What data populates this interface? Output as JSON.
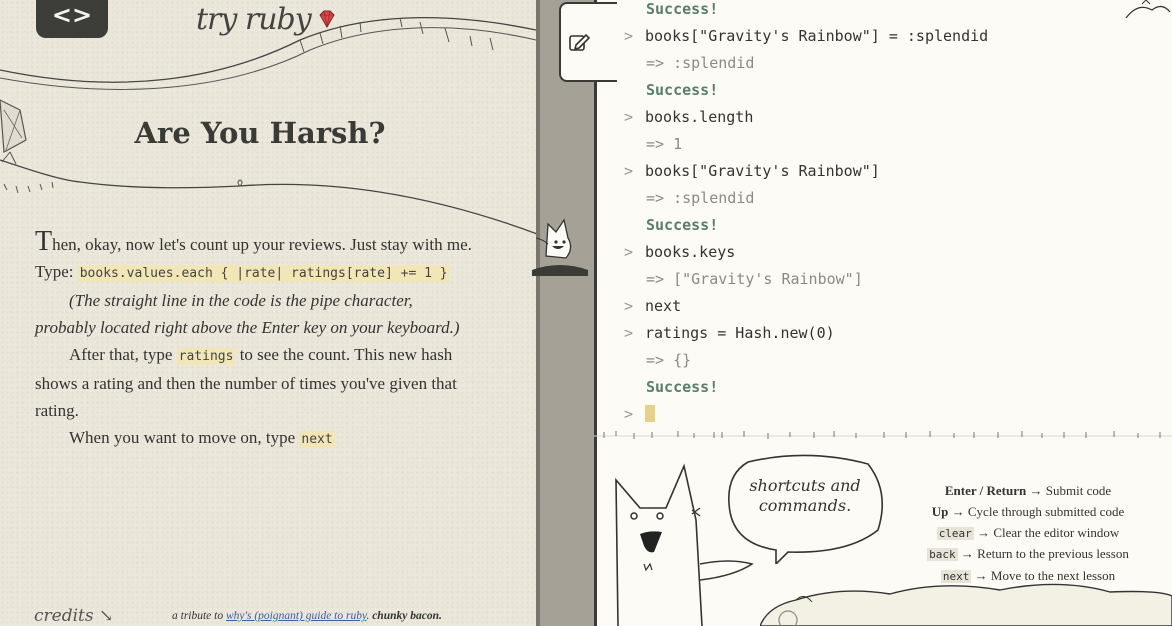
{
  "brand": {
    "logo_icon": "code-brackets",
    "name": "try ruby"
  },
  "lesson": {
    "title": "Are You Harsh?",
    "p1_dropcap": "T",
    "p1_rest": "hen, okay, now let's count up your reviews. Just stay with me. Type:",
    "code": "books.values.each { |rate| ratings[rate] += 1 }",
    "note": "(The straight line in the code is the pipe character, probably located right above the Enter key on your keyboard.)",
    "p3_before": "After that, type ",
    "p3_code": "ratings",
    "p3_after": " to see the count. This new hash shows a rating and then the number of times you've given that rating.",
    "p4_before": "When you want to move on, type ",
    "p4_code": "next"
  },
  "footer": {
    "credits": "credits",
    "tribute_prefix": "a tribute to ",
    "tribute_link": "why's (poignant) guide to ruby",
    "tribute_mid": ". ",
    "tribute_bold": "chunky bacon."
  },
  "console": {
    "prompt": ">",
    "lines": [
      {
        "type": "success",
        "text": "Success!"
      },
      {
        "type": "input",
        "text": "books[\"Gravity's Rainbow\"] = :splendid"
      },
      {
        "type": "result",
        "text": "=> :splendid"
      },
      {
        "type": "success",
        "text": "Success!"
      },
      {
        "type": "input",
        "text": "books.length"
      },
      {
        "type": "result",
        "text": "=> 1"
      },
      {
        "type": "input",
        "text": "books[\"Gravity's Rainbow\"]"
      },
      {
        "type": "result",
        "text": "=> :splendid"
      },
      {
        "type": "success",
        "text": "Success!"
      },
      {
        "type": "input",
        "text": "books.keys"
      },
      {
        "type": "result",
        "text": "=> [\"Gravity's Rainbow\"]"
      },
      {
        "type": "input",
        "text": "next"
      },
      {
        "type": "input",
        "text": "ratings = Hash.new(0)"
      },
      {
        "type": "result",
        "text": "=> {}"
      },
      {
        "type": "success",
        "text": "Success!"
      }
    ],
    "current_input": ""
  },
  "help": {
    "bubble": "shortcuts and commands.",
    "shortcuts": [
      {
        "key": "Enter / Return",
        "style": "bold",
        "desc": "Submit code"
      },
      {
        "key": "Up",
        "style": "bold",
        "desc": "Cycle through submitted code"
      },
      {
        "key": "clear",
        "style": "code",
        "desc": "Clear the editor window"
      },
      {
        "key": "back",
        "style": "code",
        "desc": "Return to the previous lesson"
      },
      {
        "key": "next",
        "style": "code",
        "desc": "Move to the next lesson"
      }
    ],
    "arrow": "→"
  },
  "colors": {
    "highlight": "#f2e6b6",
    "success": "#5a7d6d",
    "result": "#8a8a8a",
    "paper": "#ebe7da",
    "console_bg": "#fcfbf5"
  }
}
